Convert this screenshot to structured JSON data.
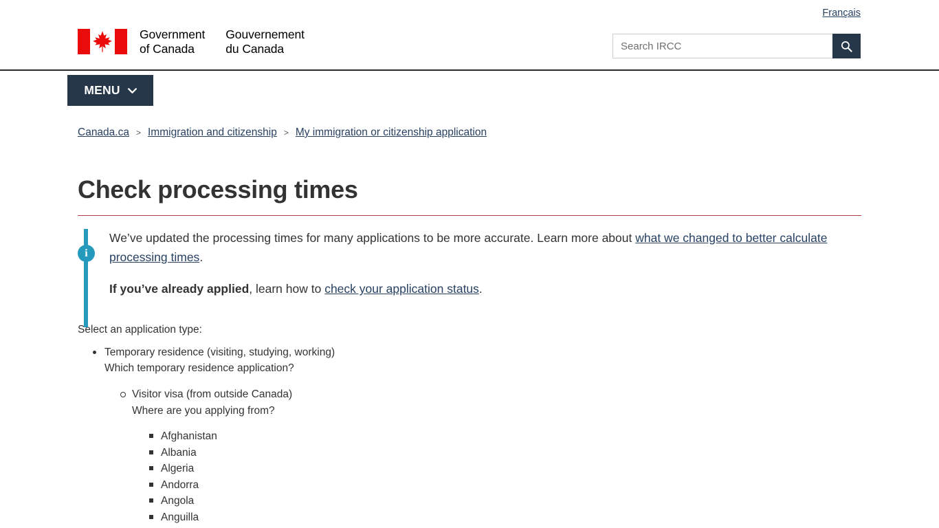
{
  "header": {
    "lang_toggle": "Français",
    "wordmark_en": "Government\nof Canada",
    "wordmark_fr": "Gouvernement\ndu Canada",
    "search_placeholder": "Search IRCC",
    "search_value": "",
    "colors": {
      "navy": "#26374A",
      "flag_red": "#EA0B0B",
      "link": "#284162"
    }
  },
  "menu": {
    "label": "MENU"
  },
  "breadcrumb": {
    "items": [
      {
        "label": "Canada.ca"
      },
      {
        "label": "Immigration and citizenship"
      },
      {
        "label": "My immigration or citizenship application"
      }
    ],
    "separator": ">"
  },
  "page": {
    "title": "Check processing times",
    "rule_color": "#AF3C43"
  },
  "notice": {
    "icon": "info-icon",
    "accent_color": "#269ABC",
    "p1_before_link": "We’ve updated the processing times for many applications to be more accurate. Learn more about ",
    "p1_link": "what we changed to better calculate processing times",
    "p1_after_link": ".",
    "p2_bold": "If you’ve already applied",
    "p2_middle": ", learn how to ",
    "p2_link": "check your application status",
    "p2_after_link": "."
  },
  "selector": {
    "label": "Select an application type:",
    "level1_label": "Temporary residence (visiting, studying, working)",
    "level1_question": "Which temporary residence application?",
    "level2_label": "Visitor visa (from outside Canada)",
    "level2_question": "Where are you applying from?",
    "countries": [
      "Afghanistan",
      "Albania",
      "Algeria",
      "Andorra",
      "Angola",
      "Anguilla"
    ]
  }
}
